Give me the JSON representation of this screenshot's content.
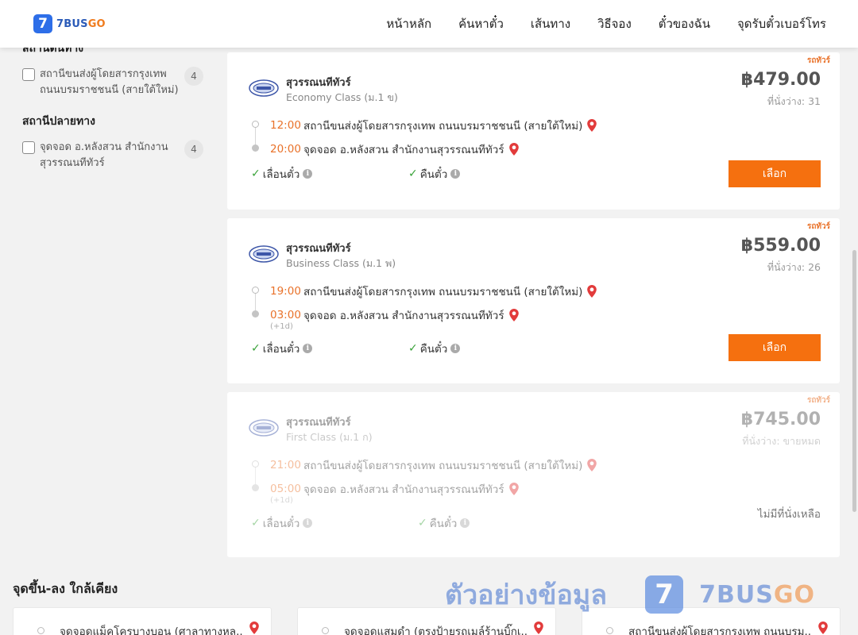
{
  "brand": {
    "logo_mark": "7",
    "name_a": "7BUS",
    "name_b": "GO"
  },
  "nav": [
    "หน้าหลัก",
    "ค้นหาตั๋ว",
    "เส้นทาง",
    "วิธีจอง",
    "ตั๋วของฉัน",
    "จุดรับตั๋วเบอร์โทร"
  ],
  "filters": {
    "origin_title": "สถานีต้นทาง",
    "origin_option": {
      "label": "สถานีขนส่งผู้โดยสารกรุงเทพ ถนนบรมราชชนนี (สายใต้ใหม่)",
      "count": "4"
    },
    "dest_title": "สถานีปลายทาง",
    "dest_option": {
      "label": "จุดจอด อ.หลังสวน สำนักงานสุวรรณนทีทัวร์",
      "count": "4"
    }
  },
  "trips": [
    {
      "promo": "รถทัวร์",
      "operator": "สุวรรณนทีทัวร์",
      "class": "Economy Class (ม.1 ข)",
      "price": "฿479.00",
      "seats": "ที่นั่งว่าง: 31",
      "dep_time": "12:00",
      "dep_station": "สถานีขนส่งผู้โดยสารกรุงเทพ ถนนบรมราชชนนี (สายใต้ใหม่)",
      "arr_time": "20:00",
      "arr_station": "จุดจอด อ.หลังสวน สำนักงานสุวรรณนทีทัวร์",
      "next_day": "",
      "feature_1": "เลื่อนตั๋ว",
      "feature_2": "คืนตั๋ว",
      "action": "เลือก"
    },
    {
      "promo": "รถทัวร์",
      "operator": "สุวรรณนทีทัวร์",
      "class": "Business Class (ม.1 พ)",
      "price": "฿559.00",
      "seats": "ที่นั่งว่าง: 26",
      "dep_time": "19:00",
      "dep_station": "สถานีขนส่งผู้โดยสารกรุงเทพ ถนนบรมราชชนนี (สายใต้ใหม่)",
      "arr_time": "03:00",
      "arr_station": "จุดจอด อ.หลังสวน สำนักงานสุวรรณนทีทัวร์",
      "next_day": "(+1d)",
      "feature_1": "เลื่อนตั๋ว",
      "feature_2": "คืนตั๋ว",
      "action": "เลือก"
    },
    {
      "promo": "รถทัวร์",
      "operator": "สุวรรณนทีทัวร์",
      "class": "First Class (ม.1 ก)",
      "price": "฿745.00",
      "seats": "ที่นั่งว่าง: ขายหมด",
      "dep_time": "21:00",
      "dep_station": "สถานีขนส่งผู้โดยสารกรุงเทพ ถนนบรมราชชนนี (สายใต้ใหม่)",
      "arr_time": "05:00",
      "arr_station": "จุดจอด อ.หลังสวน สำนักงานสุวรรณนทีทัวร์",
      "next_day": "(+1d)",
      "feature_1": "เลื่อนตั๋ว",
      "feature_2": "คืนตั๋ว",
      "action": "ไม่มีที่นั่งเหลือ"
    }
  ],
  "nearby": {
    "title": "จุดขึ้น-ลง ใกล้เคียง",
    "items": [
      "จุดจอดแม็คโครบางบอน (ศาลาทางหล...",
      "จุดจอดแสมดำ (ตรงป้ายรถเมล์ร้านบิ๊กเ...",
      "สถานีขนส่งผู้โดยสารกรุงเทพ ถนนบรม..."
    ]
  },
  "watermark": {
    "text": "ตัวอย่างข้อมูล",
    "mark": "7",
    "brand_a": "7BUS",
    "brand_b": "GO"
  },
  "colors": {
    "accent": "#f5700f",
    "time": "#e9722a",
    "brand_blue": "#2d6ee8",
    "check": "#3aa33a",
    "pin": "#e23b3b"
  }
}
